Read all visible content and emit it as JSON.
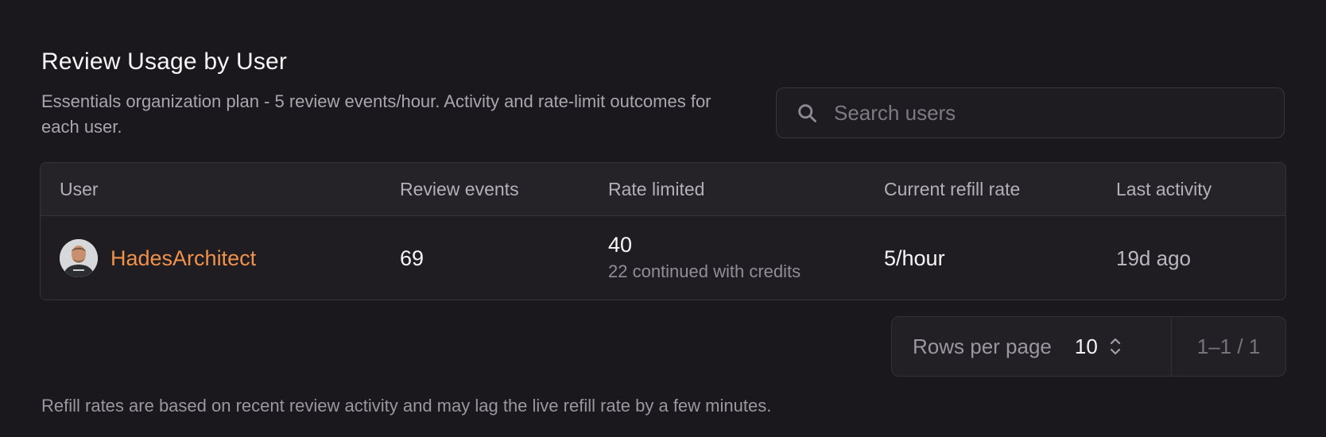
{
  "header": {
    "title": "Review Usage by User",
    "subtitle": "Essentials organization plan - 5 review events/hour. Activity and rate-limit outcomes for each user."
  },
  "search": {
    "placeholder": "Search users",
    "value": "",
    "icon": "search-icon"
  },
  "table": {
    "columns": [
      "User",
      "Review events",
      "Rate limited",
      "Current refill rate",
      "Last activity"
    ],
    "rows": [
      {
        "user": "HadesArchitect",
        "avatar_icon": "user-avatar",
        "review_events": "69",
        "rate_limited": "40",
        "rate_limited_note": "22 continued with credits",
        "current_refill_rate": "5/hour",
        "last_activity": "19d ago"
      }
    ]
  },
  "pagination": {
    "rows_per_page_label": "Rows per page",
    "rows_per_page_value": "10",
    "range": "1–1 / 1",
    "chevron_icon": "chevron-updown-icon"
  },
  "footnote": "Refill rates are based on recent review activity and may lag the live refill rate by a few minutes.",
  "colors": {
    "background": "#1a181c",
    "accent_username": "#f0924a",
    "muted_text": "#a9a6ad",
    "border": "#353238"
  }
}
